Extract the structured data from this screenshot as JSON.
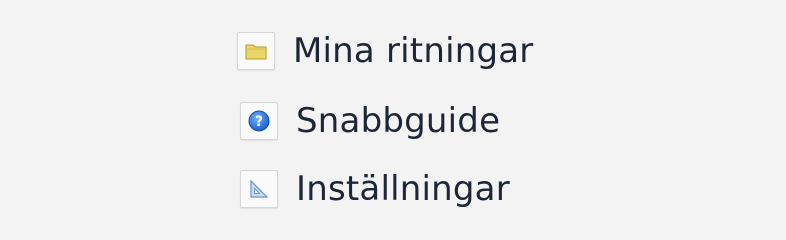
{
  "menu": {
    "items": [
      {
        "label": "Mina ritningar",
        "icon": "folder-icon"
      },
      {
        "label": "Snabbguide",
        "icon": "help-icon"
      },
      {
        "label": "Inställningar",
        "icon": "set-square-icon"
      }
    ]
  },
  "colors": {
    "background": "#f3f3f3",
    "text": "#1c2638",
    "folder": "#e9d56a",
    "help": "#2f7de0",
    "set_square": "#8fb0d9"
  }
}
